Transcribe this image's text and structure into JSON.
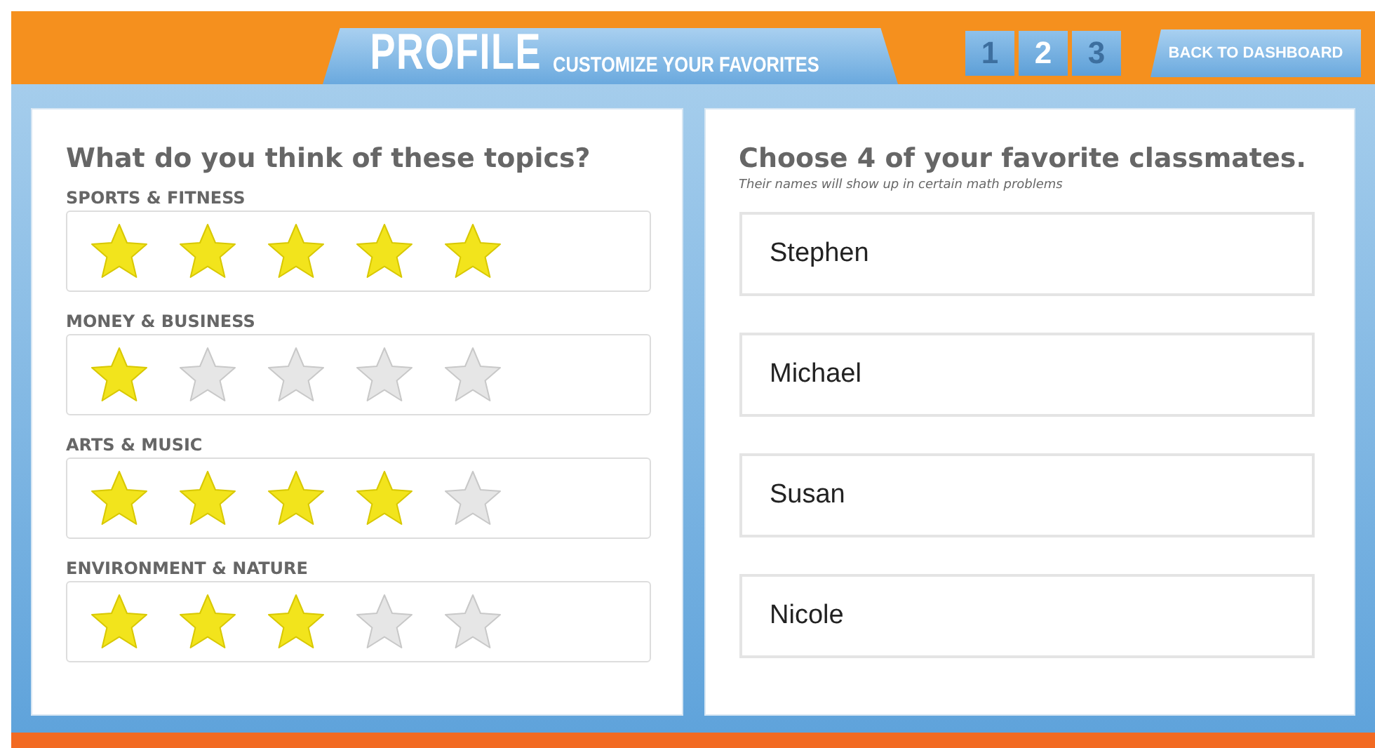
{
  "header": {
    "title": "PROFILE",
    "subtitle": "CUSTOMIZE YOUR FAVORITES",
    "steps": [
      {
        "label": "1",
        "selected": false
      },
      {
        "label": "2",
        "selected": true
      },
      {
        "label": "3",
        "selected": false
      }
    ],
    "back_button": "BACK TO DASHBOARD"
  },
  "topics_panel": {
    "heading": "What do you think of these topics?",
    "topics": [
      {
        "label": "SPORTS & FITNESS",
        "stars": 5
      },
      {
        "label": "MONEY & BUSINESS",
        "stars": 1
      },
      {
        "label": "ARTS & MUSIC",
        "stars": 4
      },
      {
        "label": "ENVIRONMENT & NATURE",
        "stars": 3
      }
    ]
  },
  "classmates_panel": {
    "heading": "Choose 4 of your favorite classmates.",
    "note": "Their names will show up in certain math problems",
    "names": [
      "Stephen",
      "Michael",
      "Susan",
      "Nicole"
    ]
  }
}
